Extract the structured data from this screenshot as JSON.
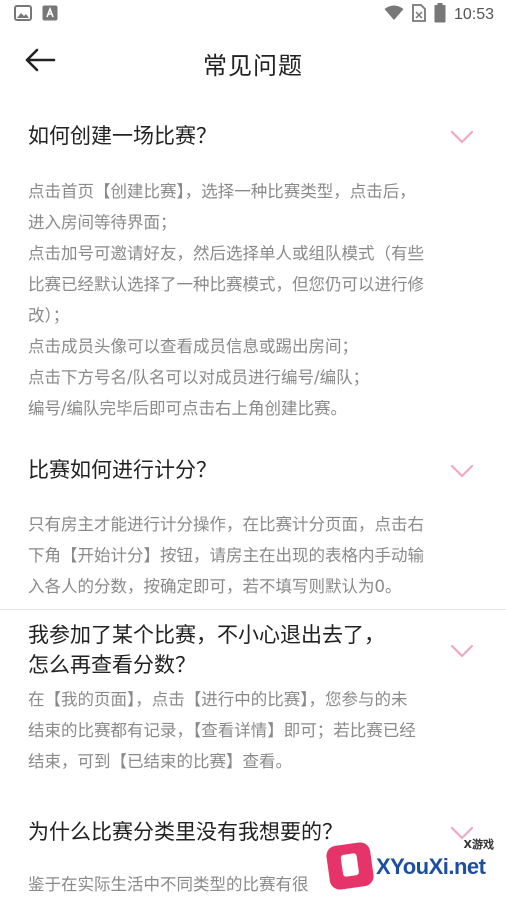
{
  "status_bar": {
    "time": "10:53"
  },
  "header": {
    "title": "常见问题"
  },
  "faq": [
    {
      "question": "如何创建一场比赛？",
      "answer_lines": [
        "点击首页【创建比赛】，选择一种比赛类型，点击后，",
        "进入房间等待界面；",
        "点击加号可邀请好友，然后选择单人或组队模式（有些",
        "比赛已经默认选择了一种比赛模式，但您仍可以进行修",
        "改）；",
        "点击成员头像可以查看成员信息或踢出房间；",
        "点击下方号名/队名可以对成员进行编号/编队；",
        "编号/编队完毕后即可点击右上角创建比赛。"
      ]
    },
    {
      "question": "比赛如何进行计分？",
      "answer_lines": [
        "只有房主才能进行计分操作，在比赛计分页面，点击右",
        "下角【开始计分】按钮，请房主在出现的表格内手动输",
        "入各人的分数，按确定即可，若不填写则默认为0。"
      ]
    },
    {
      "question_lines": [
        "我参加了某个比赛，不小心退出去了，",
        "怎么再查看分数？"
      ],
      "answer_lines": [
        "在【我的页面】，点击【进行中的比赛】，您参与的未",
        "结束的比赛都有记录，【查看详情】即可；若比赛已经",
        "结束，可到【已结束的比赛】查看。"
      ]
    },
    {
      "question": "为什么比赛分类里没有我想要的？",
      "answer_lines": [
        "鉴于在实际生活中不同类型的比赛有很"
      ]
    }
  ],
  "watermark": {
    "small": "X游戏",
    "brand": "XYouXi.net"
  },
  "colors": {
    "chevron": "#f0a8c0",
    "answer_text": "#8a8a8a",
    "question_text": "#222222"
  }
}
